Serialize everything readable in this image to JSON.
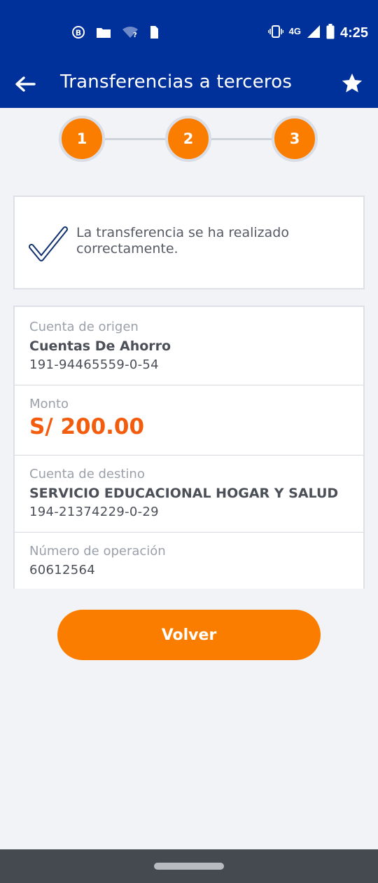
{
  "status_bar": {
    "time": "4:25",
    "network": "4G",
    "icons": [
      "b-circle-icon",
      "folder-icon",
      "wifi-question-icon",
      "sim-icon",
      "vibrate-icon",
      "signal-icon",
      "battery-icon"
    ]
  },
  "app_bar": {
    "title": "Transferencias a terceros",
    "back_icon": "arrow-left-icon",
    "favorite_icon": "star-icon"
  },
  "stepper": {
    "steps": [
      "1",
      "2",
      "3"
    ],
    "current": 3
  },
  "success": {
    "message": "La transferencia se ha realizado correctamente.",
    "icon": "check-icon"
  },
  "details": {
    "origin_label": "Cuenta de origen",
    "origin_name": "Cuentas De Ahorro",
    "origin_number": "191-94465559-0-54",
    "amount_label": "Monto",
    "amount_value": "S/ 200.00",
    "destination_label": "Cuenta de destino",
    "destination_name": "SERVICIO EDUCACIONAL HOGAR Y SALUD",
    "destination_number": "194-21374229-0-29",
    "operation_label": "Número de operación",
    "operation_number": "60612564"
  },
  "actions": {
    "back_label": "Volver"
  },
  "colors": {
    "primary": "#00309a",
    "accent": "#fb7d00",
    "amount": "#f35c0c",
    "background": "#f2f3f7"
  }
}
